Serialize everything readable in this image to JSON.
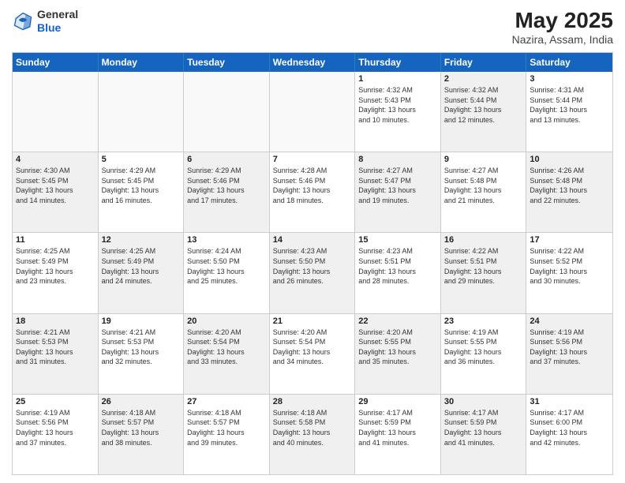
{
  "header": {
    "logo": {
      "general": "General",
      "blue": "Blue"
    },
    "title": "May 2025",
    "subtitle": "Nazira, Assam, India"
  },
  "dayNames": [
    "Sunday",
    "Monday",
    "Tuesday",
    "Wednesday",
    "Thursday",
    "Friday",
    "Saturday"
  ],
  "weeks": [
    [
      {
        "date": "",
        "info": ""
      },
      {
        "date": "",
        "info": ""
      },
      {
        "date": "",
        "info": ""
      },
      {
        "date": "",
        "info": ""
      },
      {
        "date": "1",
        "info": "Sunrise: 4:32 AM\nSunset: 5:43 PM\nDaylight: 13 hours\nand 10 minutes."
      },
      {
        "date": "2",
        "info": "Sunrise: 4:32 AM\nSunset: 5:44 PM\nDaylight: 13 hours\nand 12 minutes."
      },
      {
        "date": "3",
        "info": "Sunrise: 4:31 AM\nSunset: 5:44 PM\nDaylight: 13 hours\nand 13 minutes."
      }
    ],
    [
      {
        "date": "4",
        "info": "Sunrise: 4:30 AM\nSunset: 5:45 PM\nDaylight: 13 hours\nand 14 minutes."
      },
      {
        "date": "5",
        "info": "Sunrise: 4:29 AM\nSunset: 5:45 PM\nDaylight: 13 hours\nand 16 minutes."
      },
      {
        "date": "6",
        "info": "Sunrise: 4:29 AM\nSunset: 5:46 PM\nDaylight: 13 hours\nand 17 minutes."
      },
      {
        "date": "7",
        "info": "Sunrise: 4:28 AM\nSunset: 5:46 PM\nDaylight: 13 hours\nand 18 minutes."
      },
      {
        "date": "8",
        "info": "Sunrise: 4:27 AM\nSunset: 5:47 PM\nDaylight: 13 hours\nand 19 minutes."
      },
      {
        "date": "9",
        "info": "Sunrise: 4:27 AM\nSunset: 5:48 PM\nDaylight: 13 hours\nand 21 minutes."
      },
      {
        "date": "10",
        "info": "Sunrise: 4:26 AM\nSunset: 5:48 PM\nDaylight: 13 hours\nand 22 minutes."
      }
    ],
    [
      {
        "date": "11",
        "info": "Sunrise: 4:25 AM\nSunset: 5:49 PM\nDaylight: 13 hours\nand 23 minutes."
      },
      {
        "date": "12",
        "info": "Sunrise: 4:25 AM\nSunset: 5:49 PM\nDaylight: 13 hours\nand 24 minutes."
      },
      {
        "date": "13",
        "info": "Sunrise: 4:24 AM\nSunset: 5:50 PM\nDaylight: 13 hours\nand 25 minutes."
      },
      {
        "date": "14",
        "info": "Sunrise: 4:23 AM\nSunset: 5:50 PM\nDaylight: 13 hours\nand 26 minutes."
      },
      {
        "date": "15",
        "info": "Sunrise: 4:23 AM\nSunset: 5:51 PM\nDaylight: 13 hours\nand 28 minutes."
      },
      {
        "date": "16",
        "info": "Sunrise: 4:22 AM\nSunset: 5:51 PM\nDaylight: 13 hours\nand 29 minutes."
      },
      {
        "date": "17",
        "info": "Sunrise: 4:22 AM\nSunset: 5:52 PM\nDaylight: 13 hours\nand 30 minutes."
      }
    ],
    [
      {
        "date": "18",
        "info": "Sunrise: 4:21 AM\nSunset: 5:53 PM\nDaylight: 13 hours\nand 31 minutes."
      },
      {
        "date": "19",
        "info": "Sunrise: 4:21 AM\nSunset: 5:53 PM\nDaylight: 13 hours\nand 32 minutes."
      },
      {
        "date": "20",
        "info": "Sunrise: 4:20 AM\nSunset: 5:54 PM\nDaylight: 13 hours\nand 33 minutes."
      },
      {
        "date": "21",
        "info": "Sunrise: 4:20 AM\nSunset: 5:54 PM\nDaylight: 13 hours\nand 34 minutes."
      },
      {
        "date": "22",
        "info": "Sunrise: 4:20 AM\nSunset: 5:55 PM\nDaylight: 13 hours\nand 35 minutes."
      },
      {
        "date": "23",
        "info": "Sunrise: 4:19 AM\nSunset: 5:55 PM\nDaylight: 13 hours\nand 36 minutes."
      },
      {
        "date": "24",
        "info": "Sunrise: 4:19 AM\nSunset: 5:56 PM\nDaylight: 13 hours\nand 37 minutes."
      }
    ],
    [
      {
        "date": "25",
        "info": "Sunrise: 4:19 AM\nSunset: 5:56 PM\nDaylight: 13 hours\nand 37 minutes."
      },
      {
        "date": "26",
        "info": "Sunrise: 4:18 AM\nSunset: 5:57 PM\nDaylight: 13 hours\nand 38 minutes."
      },
      {
        "date": "27",
        "info": "Sunrise: 4:18 AM\nSunset: 5:57 PM\nDaylight: 13 hours\nand 39 minutes."
      },
      {
        "date": "28",
        "info": "Sunrise: 4:18 AM\nSunset: 5:58 PM\nDaylight: 13 hours\nand 40 minutes."
      },
      {
        "date": "29",
        "info": "Sunrise: 4:17 AM\nSunset: 5:59 PM\nDaylight: 13 hours\nand 41 minutes."
      },
      {
        "date": "30",
        "info": "Sunrise: 4:17 AM\nSunset: 5:59 PM\nDaylight: 13 hours\nand 41 minutes."
      },
      {
        "date": "31",
        "info": "Sunrise: 4:17 AM\nSunset: 6:00 PM\nDaylight: 13 hours\nand 42 minutes."
      }
    ]
  ]
}
